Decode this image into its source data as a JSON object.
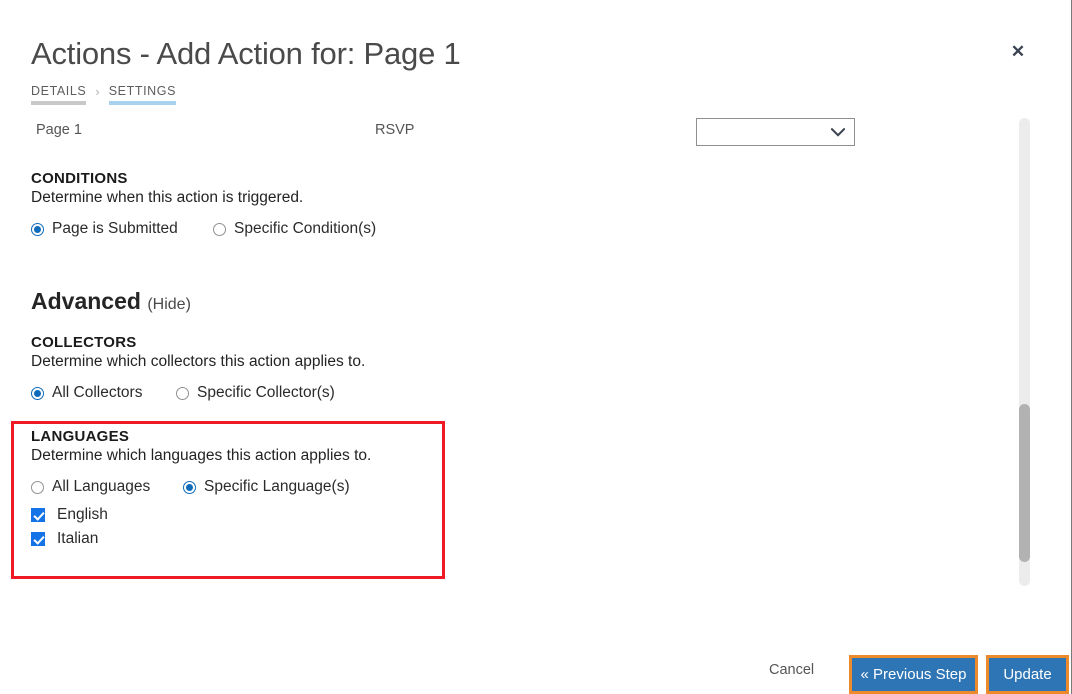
{
  "dialog": {
    "title": "Actions - Add Action for: Page 1",
    "close_icon": "close-icon"
  },
  "steps": [
    {
      "label": "DETAILS",
      "state": "done"
    },
    {
      "label": "SETTINGS",
      "state": "active"
    }
  ],
  "step_separator": "›",
  "meta": {
    "page_label": "Page 1",
    "action_label": "RSVP",
    "select_value": "",
    "select_icon": "chevron-down-icon"
  },
  "conditions": {
    "heading": "CONDITIONS",
    "description": "Determine when this action is triggered.",
    "options": [
      {
        "label": "Page is Submitted",
        "selected": true
      },
      {
        "label": "Specific Condition(s)",
        "selected": false
      }
    ]
  },
  "advanced": {
    "title": "Advanced",
    "toggle_label": "(Hide)"
  },
  "collectors": {
    "heading": "COLLECTORS",
    "description": "Determine which collectors this action applies to.",
    "options": [
      {
        "label": "All Collectors",
        "selected": true
      },
      {
        "label": "Specific Collector(s)",
        "selected": false
      }
    ]
  },
  "languages": {
    "heading": "LANGUAGES",
    "description": "Determine which languages this action applies to.",
    "options": [
      {
        "label": "All Languages",
        "selected": false
      },
      {
        "label": "Specific Language(s)",
        "selected": true
      }
    ],
    "items": [
      {
        "label": "English",
        "checked": true
      },
      {
        "label": "Italian",
        "checked": true
      }
    ],
    "highlight_color": "#ee1b24"
  },
  "footer": {
    "cancel_label": "Cancel",
    "previous_label": "« Previous Step",
    "update_label": "Update",
    "button_color": "#2e75b6",
    "focus_ring_color": "#ed8b2c"
  },
  "scrollbar": {
    "track_color": "#ececec",
    "thumb_color": "#b2b2b2"
  }
}
